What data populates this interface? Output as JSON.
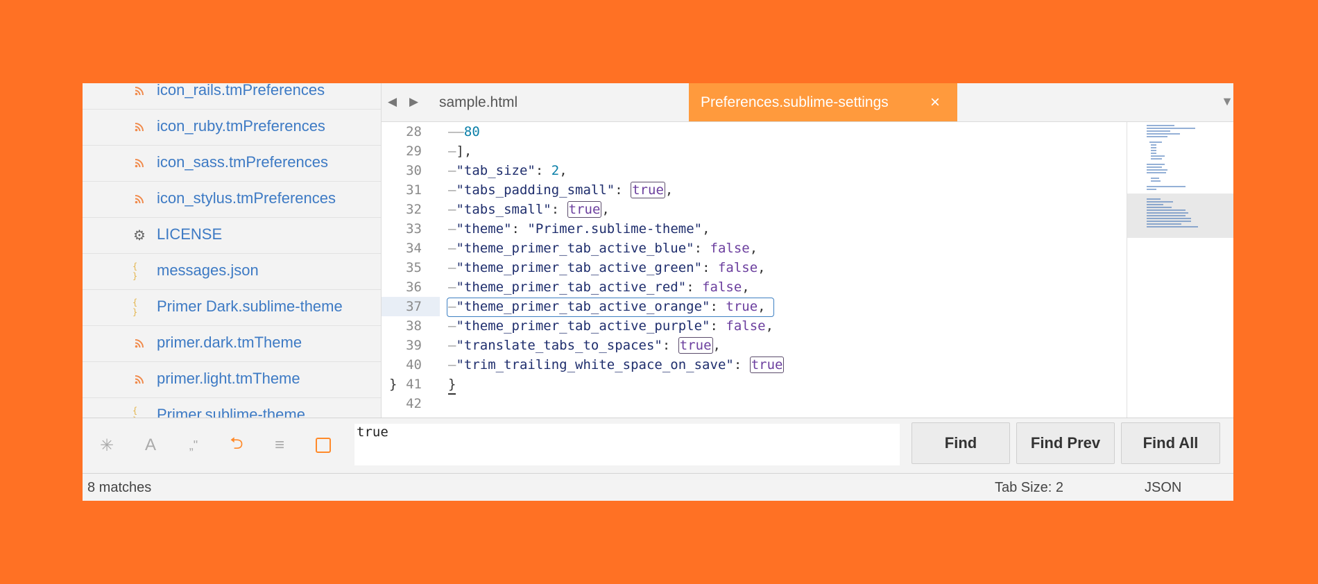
{
  "sidebar": {
    "items": [
      {
        "label": "icon_rails.tmPreferences",
        "icon": "rss-icon"
      },
      {
        "label": "icon_ruby.tmPreferences",
        "icon": "rss-icon"
      },
      {
        "label": "icon_sass.tmPreferences",
        "icon": "rss-icon"
      },
      {
        "label": "icon_stylus.tmPreferences",
        "icon": "rss-icon"
      },
      {
        "label": "LICENSE",
        "icon": "gear-icon"
      },
      {
        "label": "messages.json",
        "icon": "braces-icon"
      },
      {
        "label": "Primer Dark.sublime-theme",
        "icon": "braces-icon"
      },
      {
        "label": "primer.dark.tmTheme",
        "icon": "rss-icon"
      },
      {
        "label": "primer.light.tmTheme",
        "icon": "rss-icon"
      },
      {
        "label": "Primer.sublime-theme",
        "icon": "braces-icon"
      }
    ]
  },
  "tabs": [
    {
      "label": "sample.html",
      "active": false
    },
    {
      "label": "Preferences.sublime-settings",
      "active": true
    }
  ],
  "editor": {
    "current_line": 37,
    "lines": [
      {
        "num": "28"
      },
      {
        "num": "29"
      },
      {
        "num": "30"
      },
      {
        "num": "31"
      },
      {
        "num": "32"
      },
      {
        "num": "33"
      },
      {
        "num": "34"
      },
      {
        "num": "35"
      },
      {
        "num": "36"
      },
      {
        "num": "37"
      },
      {
        "num": "38"
      },
      {
        "num": "39"
      },
      {
        "num": "40"
      },
      {
        "num": "41"
      },
      {
        "num": "42"
      }
    ],
    "code": {
      "l28_val": "80",
      "l29": "],",
      "l30_key": "\"tab_size\"",
      "l30_val": "2",
      "l31_key": "\"tabs_padding_small\"",
      "l31_val": "true",
      "l32_key": "\"tabs_small\"",
      "l32_val": "true",
      "l33_key": "\"theme\"",
      "l33_val": "\"Primer.sublime-theme\"",
      "l34_key": "\"theme_primer_tab_active_blue\"",
      "l34_val": "false",
      "l35_key": "\"theme_primer_tab_active_green\"",
      "l35_val": "false",
      "l36_key": "\"theme_primer_tab_active_red\"",
      "l36_val": "false",
      "l37_key": "\"theme_primer_tab_active_orange\"",
      "l37_val": "true",
      "l38_key": "\"theme_primer_tab_active_purple\"",
      "l38_val": "false",
      "l39_key": "\"translate_tabs_to_spaces\"",
      "l39_val": "true",
      "l40_key": "\"trim_trailing_white_space_on_save\"",
      "l40_val": "true",
      "l41": "}",
      "fold_41": "}"
    }
  },
  "find": {
    "value": "true",
    "options": [
      "regex-icon",
      "case-sensitive-icon",
      "whole-word-icon",
      "wrap-icon",
      "in-selection-icon",
      "highlight-matches-icon"
    ],
    "buttons": {
      "find": "Find",
      "find_prev": "Find Prev",
      "find_all": "Find All"
    }
  },
  "status": {
    "matches": "8 matches",
    "tab_size": "Tab Size: 2",
    "syntax": "JSON"
  },
  "colors": {
    "background": "#ff7124",
    "active_tab": "#ff9a3d",
    "sidebar_link": "#3d7ac4",
    "boolean": "#6b3e9e",
    "number": "#0a7fa8"
  }
}
